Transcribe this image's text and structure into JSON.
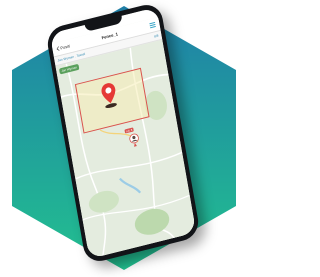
{
  "theme": {
    "hex_top": "#1f7fa8",
    "hex_bottom": "#22c08f",
    "accent": "#3aa6c8",
    "fence_border": "#d9534f",
    "pin": "#e53935"
  },
  "nav": {
    "back_label": "Positi",
    "title": "Fence_1",
    "back_icon": "chevron-left-icon",
    "menu_icon": "menu-icon"
  },
  "sub_bar": {
    "left_text": "Jan Wyman . Tassel",
    "right_text": "8/8"
  },
  "map": {
    "chip_text": "Jan Wyman",
    "device_label": "Lat: 8"
  }
}
